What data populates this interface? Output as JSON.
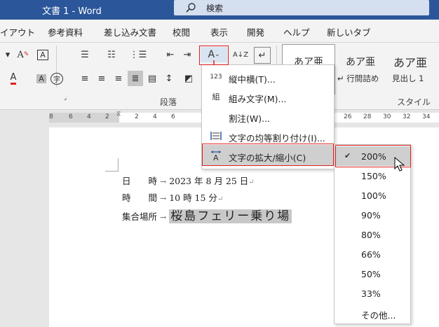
{
  "window": {
    "title": "文書 1  -  Word"
  },
  "search": {
    "text": "検索"
  },
  "tabs": [
    "イアウト",
    "参考資料",
    "差し込み文書",
    "校閲",
    "表示",
    "開発",
    "ヘルプ",
    "新しいタブ"
  ],
  "ribbon": {
    "group_paragraph": "段落",
    "group_style": "スタイル",
    "styles": [
      {
        "sample": "あア亜",
        "name": ""
      },
      {
        "sample": "あア亜",
        "name": "↵ 行間詰め"
      },
      {
        "sample": "あア亜",
        "name": "見出し 1"
      }
    ]
  },
  "ruler": {
    "numbers": [
      "8",
      "6",
      "4",
      "2",
      "2",
      "4",
      "6",
      "26",
      "28",
      "30",
      "32",
      "34"
    ]
  },
  "document": {
    "lines": [
      {
        "label": "日　　時",
        "value": "2023 年 8 月 25 日"
      },
      {
        "label": "時　　間",
        "value": "10 時 15 分"
      },
      {
        "label": "集合場所",
        "value": "桜島フェリー乗り場"
      }
    ],
    "tab_arrow": "→",
    "para_mark": "↵"
  },
  "menu_asian_layout": {
    "items": [
      {
        "label": "縦中横(T)...",
        "icon": "123"
      },
      {
        "label": "組み文字(M)...",
        "icon": "組"
      },
      {
        "label": "割注(W)...",
        "icon": ""
      },
      {
        "label": "文字の均等割り付け(I)...",
        "icon": "distribute-icon"
      },
      {
        "label": "文字の拡大/縮小(C)",
        "icon": "scale-icon"
      }
    ]
  },
  "menu_scale": {
    "items": [
      "200%",
      "150%",
      "100%",
      "90%",
      "80%",
      "66%",
      "50%",
      "33%",
      "その他..."
    ],
    "selected": "200%"
  },
  "colors": {
    "accent": "#2b579a",
    "highlight": "#e02020"
  }
}
